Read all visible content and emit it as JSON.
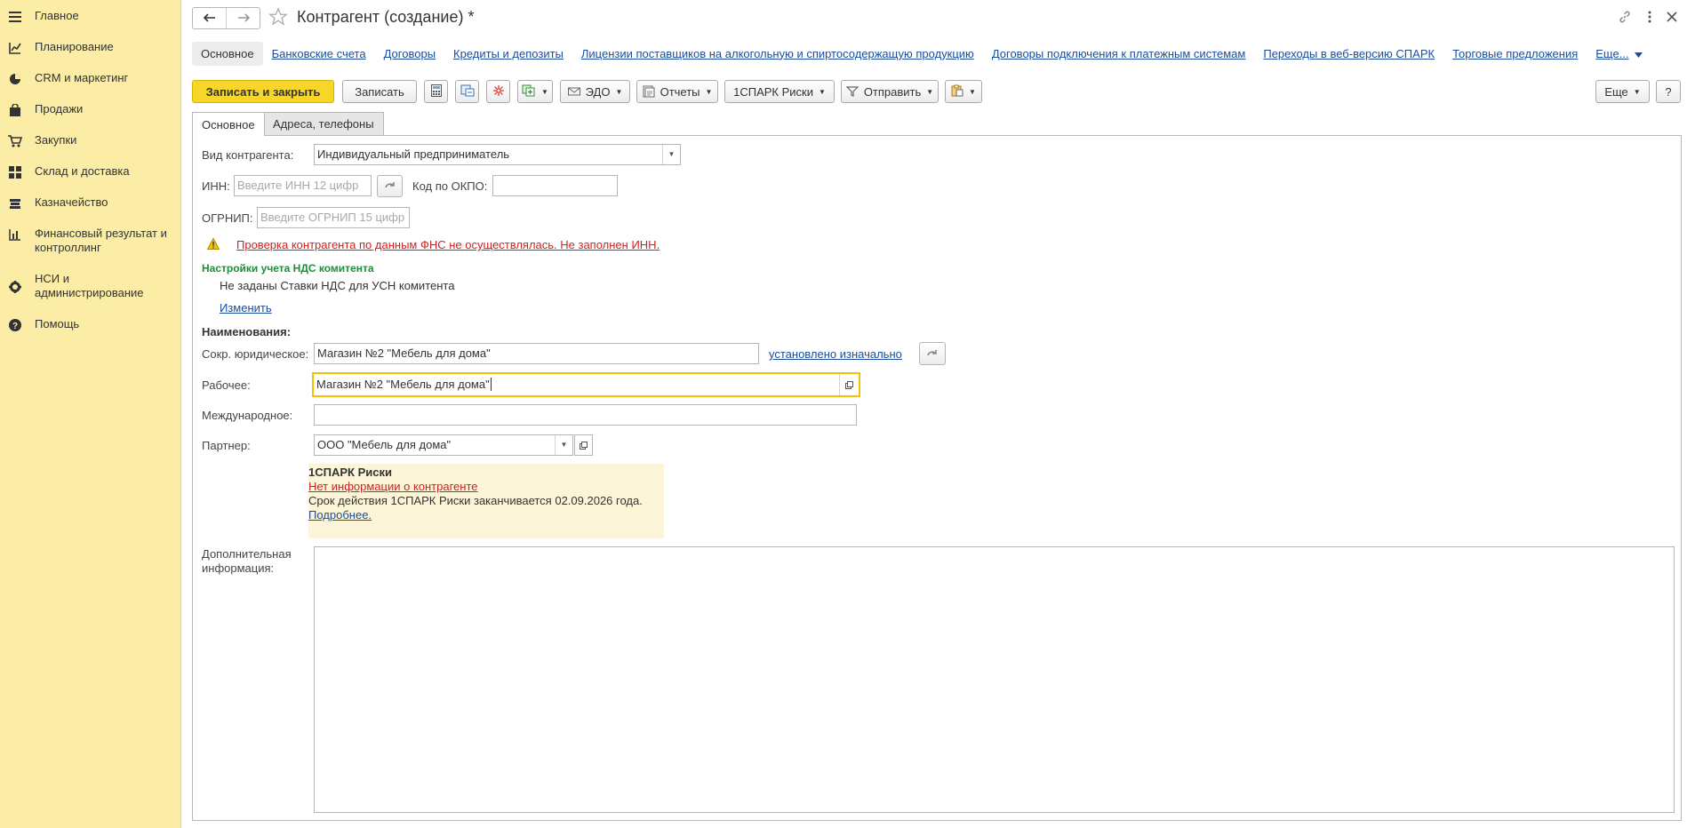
{
  "sidebar": {
    "items": [
      {
        "label": "Главное",
        "icon": "hamburger-menu-icon"
      },
      {
        "label": "Планирование",
        "icon": "planning-chart-icon"
      },
      {
        "label": "CRM и маркетинг",
        "icon": "pie-chart-icon"
      },
      {
        "label": "Продажи",
        "icon": "shopping-bag-icon"
      },
      {
        "label": "Закупки",
        "icon": "shopping-cart-icon"
      },
      {
        "label": "Склад и доставка",
        "icon": "warehouse-grid-icon"
      },
      {
        "label": "Казначейство",
        "icon": "treasury-icon"
      },
      {
        "label": "Финансовый результат и контроллинг",
        "icon": "bar-chart-icon"
      },
      {
        "label": "НСИ и администрирование",
        "icon": "gear-icon"
      },
      {
        "label": "Помощь",
        "icon": "help-icon"
      }
    ]
  },
  "header": {
    "title": "Контрагент (создание) *"
  },
  "links": {
    "active": "Основное",
    "items": [
      "Банковские счета",
      "Договоры",
      "Кредиты и депозиты",
      "Лицензии поставщиков на алкогольную и спиртосодержащую продукцию",
      "Договоры подключения к платежным системам",
      "Переходы в веб-версию СПАРК",
      "Торговые предложения"
    ],
    "more": "Еще..."
  },
  "toolbar": {
    "save_close": "Записать и закрыть",
    "save": "Записать",
    "edo": "ЭДО",
    "reports": "Отчеты",
    "spark": "1СПАРК Риски",
    "send": "Отправить",
    "more": "Еще",
    "help": "?"
  },
  "tabs": {
    "main": "Основное",
    "addresses": "Адреса, телефоны"
  },
  "form": {
    "kind_label": "Вид контрагента:",
    "kind_value": "Индивидуальный предприниматель",
    "inn_label": "ИНН:",
    "inn_placeholder": "Введите ИНН 12 цифр",
    "okpo_label": "Код по ОКПО:",
    "okpo_value": "",
    "ogrnip_label": "ОГРНИП:",
    "ogrnip_placeholder": "Введите ОГРНИП 15 цифр",
    "fns_warning": "Проверка контрагента по данным ФНС не осуществлялась. Не заполнен ИНН.",
    "vat_header": "Настройки учета НДС комитента",
    "vat_text": "Не заданы Ставки НДС для УСН комитента",
    "vat_change": "Изменить",
    "names_header": "Наименования:",
    "short_label": "Сокр. юридическое:",
    "short_value": "Магазин №2 \"Мебель для дома\"",
    "short_status": "установлено изначально",
    "work_label": "Рабочее:",
    "work_value": "Магазин №2 \"Мебель для дома\"",
    "intl_label": "Международное:",
    "intl_value": "",
    "partner_label": "Партнер:",
    "partner_value": "ООО \"Мебель для дома\"",
    "extra_label": "Дополнительная информация:",
    "extra_value": ""
  },
  "spark_panel": {
    "title": "1СПАРК Риски",
    "no_info": "Нет информации о контрагенте",
    "expiry": "Срок действия 1СПАРК Риски заканчивается 02.09.2026 года.",
    "more": "Подробнее."
  }
}
